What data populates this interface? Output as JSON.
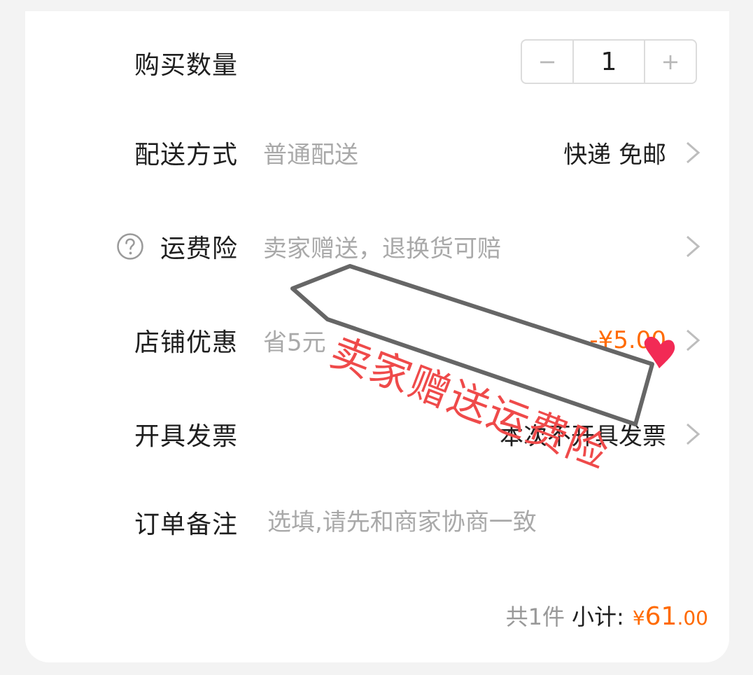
{
  "quantity": {
    "label": "购买数量",
    "minus": "−",
    "value": "1",
    "plus": "+"
  },
  "delivery": {
    "label": "配送方式",
    "hint": "普通配送",
    "value": "快递 免邮"
  },
  "insurance": {
    "label": "运费险",
    "hint": "卖家赠送，退换货可赔"
  },
  "discount": {
    "label": "店铺优惠",
    "hint": "省5元",
    "value": "-¥5.00"
  },
  "invoice": {
    "label": "开具发票",
    "value": "本次不开具发票"
  },
  "note": {
    "label": "订单备注",
    "placeholder": "选填,请先和商家协商一致"
  },
  "summary": {
    "count": "共1件",
    "label": "小计:",
    "currency": "¥",
    "amount_int": "61",
    "amount_dec": ".00"
  },
  "annotation": {
    "text": "卖家赠送运费险"
  },
  "colors": {
    "accent": "#ff6a00",
    "annotation_red": "#ef4a4a",
    "heart": "#f22a55"
  }
}
